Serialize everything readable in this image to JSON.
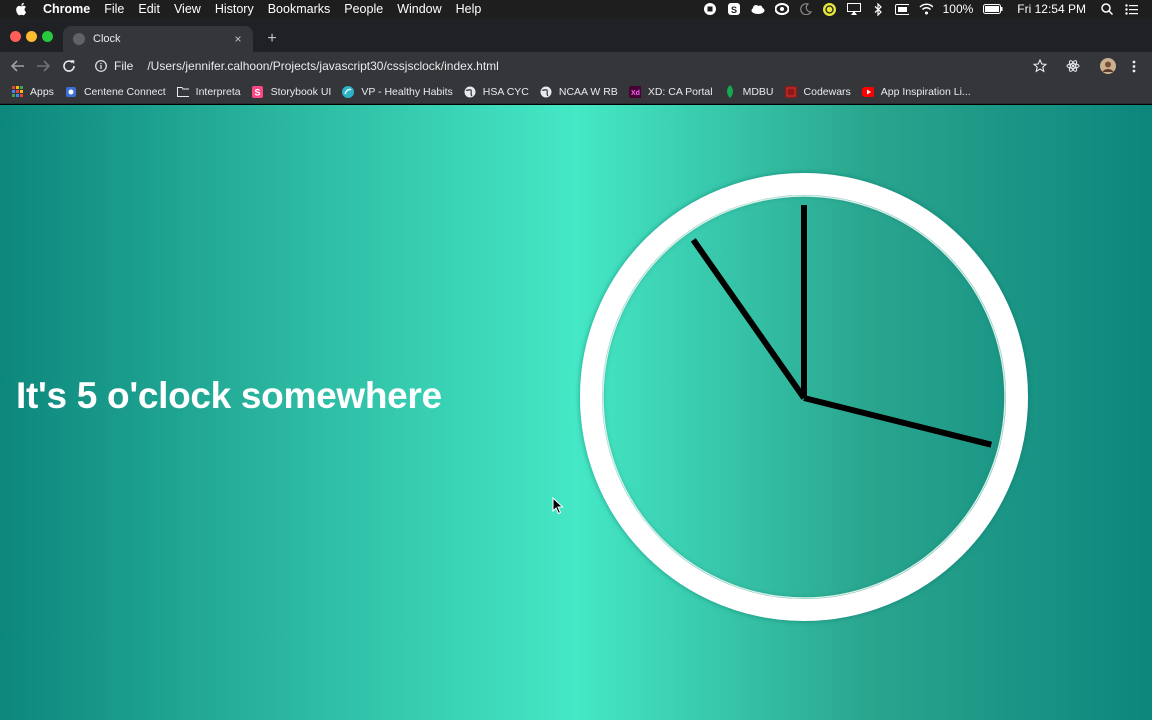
{
  "menubar": {
    "app_name": "Chrome",
    "items": [
      "File",
      "Edit",
      "View",
      "History",
      "Bookmarks",
      "People",
      "Window",
      "Help"
    ],
    "battery": "100%",
    "clock": "Fri 12:54 PM"
  },
  "tab": {
    "title": "Clock",
    "close": "×",
    "new_tab": "+"
  },
  "omnibox": {
    "scheme": "File",
    "url": "/Users/jennifer.calhoon/Projects/javascript30/cssjsclock/index.html"
  },
  "bookmarks": [
    {
      "label": "Apps",
      "icon": "apps-grid-icon"
    },
    {
      "label": "Centene Connect",
      "icon": "centene-icon"
    },
    {
      "label": "Interpreta",
      "icon": "folder-icon"
    },
    {
      "label": "Storybook UI",
      "icon": "storybook-icon"
    },
    {
      "label": "VP - Healthy Habits",
      "icon": "vp-icon"
    },
    {
      "label": "HSA CYC",
      "icon": "globe-icon"
    },
    {
      "label": "NCAA W RB",
      "icon": "globe-icon"
    },
    {
      "label": "XD: CA Portal",
      "icon": "xd-icon"
    },
    {
      "label": "MDBU",
      "icon": "leaf-icon"
    },
    {
      "label": "Codewars",
      "icon": "codewars-icon"
    },
    {
      "label": "App Inspiration Li...",
      "icon": "youtube-icon"
    }
  ],
  "page": {
    "headline": "It's 5 o'clock somewhere",
    "background_colors": [
      "#0d877c",
      "#45e8c6",
      "#0c867c"
    ]
  },
  "clock": {
    "hour_deg": 104,
    "minute_deg": 0,
    "second_deg": -35
  }
}
